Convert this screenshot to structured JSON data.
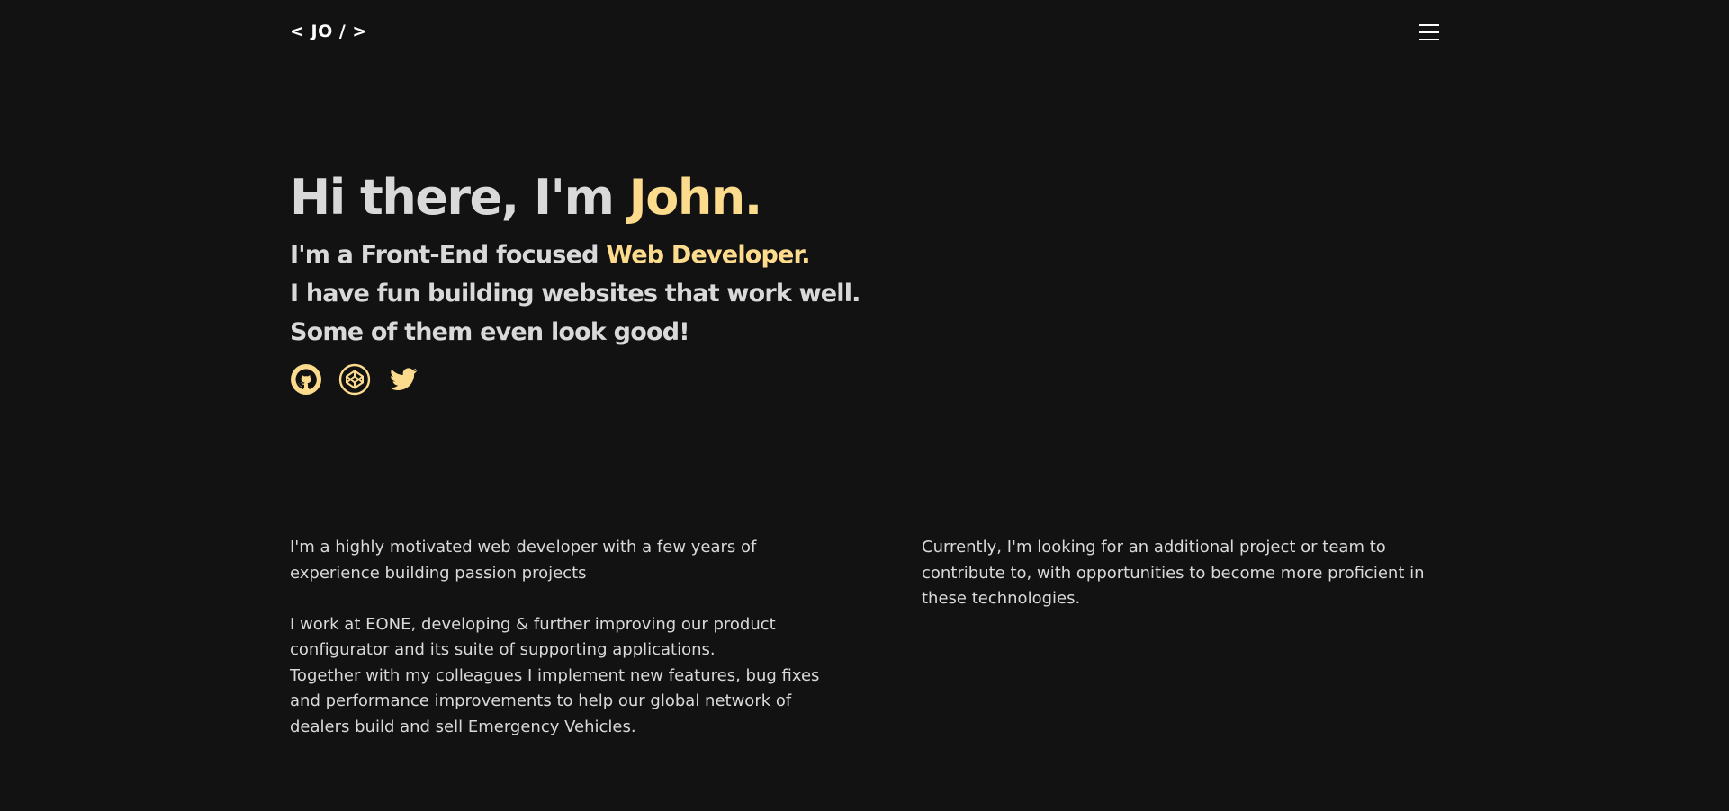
{
  "header": {
    "logo": "< JO / >",
    "menu_icon": "hamburger-menu-icon"
  },
  "hero": {
    "greeting": "Hi there, I'm ",
    "name": "John.",
    "line1_prefix": "I'm a Front-End focused ",
    "line1_role": "Web Developer.",
    "line2": "I have fun building websites that work well.",
    "line3": "Some of them even look good!",
    "accent_color": "#fddb8c"
  },
  "socials": [
    {
      "icon": "github-icon"
    },
    {
      "icon": "codepen-icon"
    },
    {
      "icon": "twitter-icon"
    }
  ],
  "about": {
    "left_p1": "I'm a highly motivated web developer with a few years of experience building passion projects",
    "left_p2": "I work at EONE, developing & further improving our product configurator and its suite of supporting applications.",
    "left_p3": "Together with my colleagues I implement new features, bug fixes and performance improvements to help our global network of dealers build and sell Emergency Vehicles.",
    "right_p1": "Currently, I'm looking for an additional project or team to contribute to, with opportunities to become more proficient in these technologies."
  },
  "colors": {
    "background": "#121212",
    "text": "#d9d9d9",
    "accent": "#fddb8c"
  }
}
